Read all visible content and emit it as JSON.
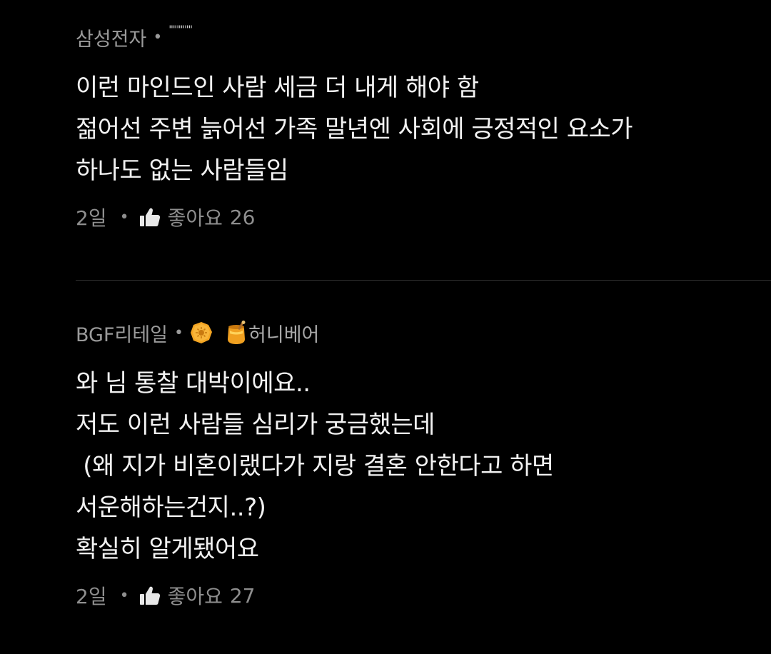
{
  "comments": [
    {
      "author": "삼성전자",
      "separator": "•",
      "badge": "\"\"\"\"\"\"",
      "lines": [
        "이런 마인드인 사람 세금 더 내게 해야 함",
        "젊어선 주변 늙어선 가족 말년엔 사회에 긍정적인 요소가",
        "하나도 없는 사람들임"
      ],
      "time": "2일",
      "like_label": "좋아요",
      "like_count": "26"
    },
    {
      "author": "BGF리테일",
      "separator": "•",
      "badge_label": "허니베어",
      "lines": [
        "와 님 통찰 대박이에요..",
        "저도 이런 사람들 심리가 궁금했는데",
        " (왜 지가 비혼이랬다가 지랑 결혼 안한다고 하면",
        "서운해하는건지..?)",
        "확실히 알게됐어요"
      ],
      "time": "2일",
      "like_label": "좋아요",
      "like_count": "27"
    }
  ],
  "colors": {
    "background": "#000000",
    "meta_text": "#9a9a9a",
    "body_text": "#f2f2f2",
    "divider": "#2e2e2e",
    "badge_orange": "#f5a623"
  },
  "icons": {
    "like": "thumbs-up-icon",
    "badge_sun": "sun-badge-icon",
    "badge_honey": "honey-pot-icon"
  }
}
